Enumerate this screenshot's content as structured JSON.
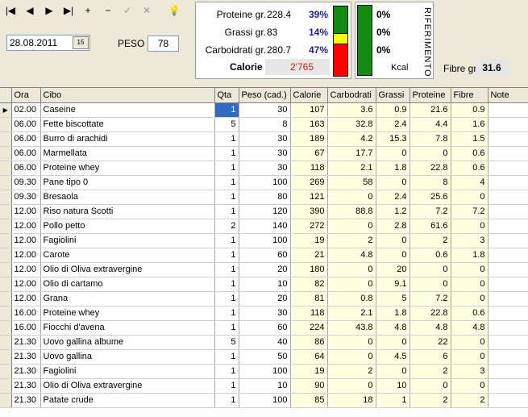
{
  "toolbar": {
    "buttons": [
      {
        "name": "first-record-button",
        "glyph": "|◀",
        "enabled": true
      },
      {
        "name": "prior-record-button",
        "glyph": "◀",
        "enabled": true
      },
      {
        "name": "next-record-button",
        "glyph": "▶",
        "enabled": true
      },
      {
        "name": "last-record-button",
        "glyph": "▶|",
        "enabled": true
      },
      {
        "name": "insert-record-button",
        "glyph": "+",
        "enabled": true
      },
      {
        "name": "delete-record-button",
        "glyph": "−",
        "enabled": true
      },
      {
        "name": "post-edit-button",
        "glyph": "✓",
        "enabled": false
      },
      {
        "name": "cancel-edit-button",
        "glyph": "✕",
        "enabled": false
      },
      {
        "name": "hint-lightbulb-button",
        "glyph": "💡",
        "enabled": true
      }
    ]
  },
  "date": {
    "value": "28.08.2011",
    "calendar_glyph": "15"
  },
  "peso": {
    "label": "PESO",
    "value": "78"
  },
  "macros": {
    "protein": {
      "label": "Proteine gr.",
      "value": "228.4",
      "pct": "39%"
    },
    "fat": {
      "label": "Grassi gr.",
      "value": "83",
      "pct": "14%"
    },
    "carbs": {
      "label": "Carboidrati gr.",
      "value": "280.7",
      "pct": "47%"
    },
    "calories": {
      "label": "Calorie",
      "value": "2'765"
    },
    "bar_colors": {
      "protein": "#138b13",
      "fat": "#ffff00",
      "carbs": "#ff0000"
    }
  },
  "reference": {
    "title": "RIFERIMENTO",
    "protein_pct": "0%",
    "fat_pct": "0%",
    "carbs_pct": "0%",
    "kcal_label": "Kcal",
    "bar_color": "#138b13"
  },
  "fibre": {
    "label": "Fibre gr.",
    "value": "31.6"
  },
  "table": {
    "columns": [
      "Ora",
      "Cibo",
      "Qta",
      "Peso (cad.)",
      "Calorie",
      "Carbodrati",
      "Grassi",
      "Proteine",
      "Fibre",
      "Note"
    ],
    "rows": [
      [
        "02.00",
        "Caseine",
        "1",
        "30",
        "107",
        "3.6",
        "0.9",
        "21.6",
        "0.9",
        ""
      ],
      [
        "06.00",
        "Fette biscottate",
        "5",
        "8",
        "163",
        "32.8",
        "2.4",
        "4.4",
        "1.6",
        ""
      ],
      [
        "06.00",
        "Burro di arachidi",
        "1",
        "30",
        "189",
        "4.2",
        "15.3",
        "7.8",
        "1.5",
        ""
      ],
      [
        "06.00",
        "Marmellata",
        "1",
        "30",
        "67",
        "17.7",
        "0",
        "0",
        "0.6",
        ""
      ],
      [
        "06.00",
        "Proteine whey",
        "1",
        "30",
        "118",
        "2.1",
        "1.8",
        "22.8",
        "0.6",
        ""
      ],
      [
        "09.30",
        "Pane tipo 0",
        "1",
        "100",
        "269",
        "58",
        "0",
        "8",
        "4",
        ""
      ],
      [
        "09.30",
        "Bresaola",
        "1",
        "80",
        "121",
        "0",
        "2.4",
        "25.6",
        "0",
        ""
      ],
      [
        "12.00",
        "Riso natura Scotti",
        "1",
        "120",
        "390",
        "88.8",
        "1.2",
        "7.2",
        "7.2",
        ""
      ],
      [
        "12.00",
        "Pollo petto",
        "2",
        "140",
        "272",
        "0",
        "2.8",
        "61.6",
        "0",
        ""
      ],
      [
        "12.00",
        "Fagiolini",
        "1",
        "100",
        "19",
        "2",
        "0",
        "2",
        "3",
        ""
      ],
      [
        "12.00",
        "Carote",
        "1",
        "60",
        "21",
        "4.8",
        "0",
        "0.6",
        "1.8",
        ""
      ],
      [
        "12.00",
        "Olio di Oliva extravergine",
        "1",
        "20",
        "180",
        "0",
        "20",
        "0",
        "0",
        ""
      ],
      [
        "12.00",
        "Olio di cartamo",
        "1",
        "10",
        "82",
        "0",
        "9.1",
        "0",
        "0",
        ""
      ],
      [
        "12.00",
        "Grana",
        "1",
        "20",
        "81",
        "0.8",
        "5",
        "7.2",
        "0",
        ""
      ],
      [
        "16.00",
        "Proteine whey",
        "1",
        "30",
        "118",
        "2.1",
        "1.8",
        "22.8",
        "0.6",
        ""
      ],
      [
        "16.00",
        "Fiocchi d'avena",
        "1",
        "60",
        "224",
        "43.8",
        "4.8",
        "4.8",
        "4.8",
        ""
      ],
      [
        "21.30",
        "Uovo gallina albume",
        "5",
        "40",
        "86",
        "0",
        "0",
        "22",
        "0",
        ""
      ],
      [
        "21.30",
        "Uovo gallina",
        "1",
        "50",
        "64",
        "0",
        "4.5",
        "6",
        "0",
        ""
      ],
      [
        "21.30",
        "Fagiolini",
        "1",
        "100",
        "19",
        "2",
        "0",
        "2",
        "3",
        ""
      ],
      [
        "21.30",
        "Olio di Oliva extravergine",
        "1",
        "10",
        "90",
        "0",
        "10",
        "0",
        "0",
        ""
      ],
      [
        "21.30",
        "Patate crude",
        "1",
        "100",
        "85",
        "18",
        "1",
        "2",
        "2",
        ""
      ]
    ]
  }
}
